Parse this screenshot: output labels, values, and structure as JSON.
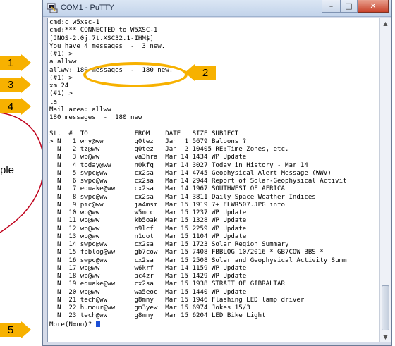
{
  "window": {
    "title": "COM1 - PuTTY",
    "buttons": {
      "minimize": "–",
      "maximize": "□",
      "close": "✕"
    }
  },
  "background_text": "ple",
  "terminal_lines": [
    "cmd:c w5xsc-1",
    "cmd:*** CONNECTED to W5XSC-1",
    "[JNOS-2.0j.7t.XSC32.1-IHM$]",
    "You have 4 messages  -  3 new.",
    "(#1) >",
    "a allww",
    "allww: 180 messages  -  180 new.",
    "(#1) >",
    "xm 24",
    "(#1) >",
    "la",
    "Mail area: allww",
    "180 messages  -  180 new",
    "",
    "St.  #  TO            FROM    DATE   SIZE SUBJECT",
    "> N   1 why@ww        g0tez   Jan  1 5679 Baloons ?",
    "  N   2 tz@ww         g0tez   Jan  2 10405 RE:Time Zones, etc.",
    "  N   3 wp@ww         va3hra  Mar 14 1434 WP Update",
    "  N   4 today@ww      n0kfq   Mar 14 3027 Today in History - Mar 14",
    "  N   5 swpc@ww       cx2sa   Mar 14 4745 Geophysical Alert Message (WWV)",
    "  N   6 swpc@ww       cx2sa   Mar 14 2944 Report of Solar-Geophysical Activit",
    "  N   7 equake@ww     cx2sa   Mar 14 1967 SOUTHWEST OF AFRICA",
    "  N   8 swpc@ww       cx2sa   Mar 14 3811 Daily Space Weather Indices",
    "  N   9 pic@ww        ja4msm  Mar 15 1919 7+ FLWR507.JPG info",
    "  N  10 wp@ww         w5mcc   Mar 15 1237 WP Update",
    "  N  11 wp@ww         kb5oak  Mar 15 1328 WP Update",
    "  N  12 wp@ww         n9lcf   Mar 15 2259 WP Update",
    "  N  13 wp@ww         n1dot   Mar 15 1104 WP Update",
    "  N  14 swpc@ww       cx2sa   Mar 15 1723 Solar Region Summary",
    "  N  15 fbblog@ww     gb7cow  Mar 15 7408 FBBLOG 10/2016 * GB7COW BBS *",
    "  N  16 swpc@ww       cx2sa   Mar 15 2508 Solar and Geophysical Activity Summ",
    "  N  17 wp@ww         w6krf   Mar 14 1159 WP Update",
    "  N  18 wp@ww         ac4zr   Mar 15 1429 WP Update",
    "  N  19 equake@ww     cx2sa   Mar 15 1938 STRAIT OF GIBRALTAR",
    "  N  20 wp@ww         wa5eoc  Mar 15 1440 WP Update",
    "  N  21 tech@ww       g8mny   Mar 15 1946 Flashing LED lamp driver",
    "  N  22 humour@ww     gm3yew  Mar 15 6974 Jokes 15/3",
    "  N  23 tech@ww       g8mny   Mar 15 6204 LED Bike Light",
    "More(N=no)? "
  ],
  "callouts": [
    "1",
    "2",
    "3",
    "4",
    "5"
  ],
  "colors": {
    "callout": "#f7b100",
    "curve": "#c0001a",
    "cursor": "#1c4fd6"
  }
}
